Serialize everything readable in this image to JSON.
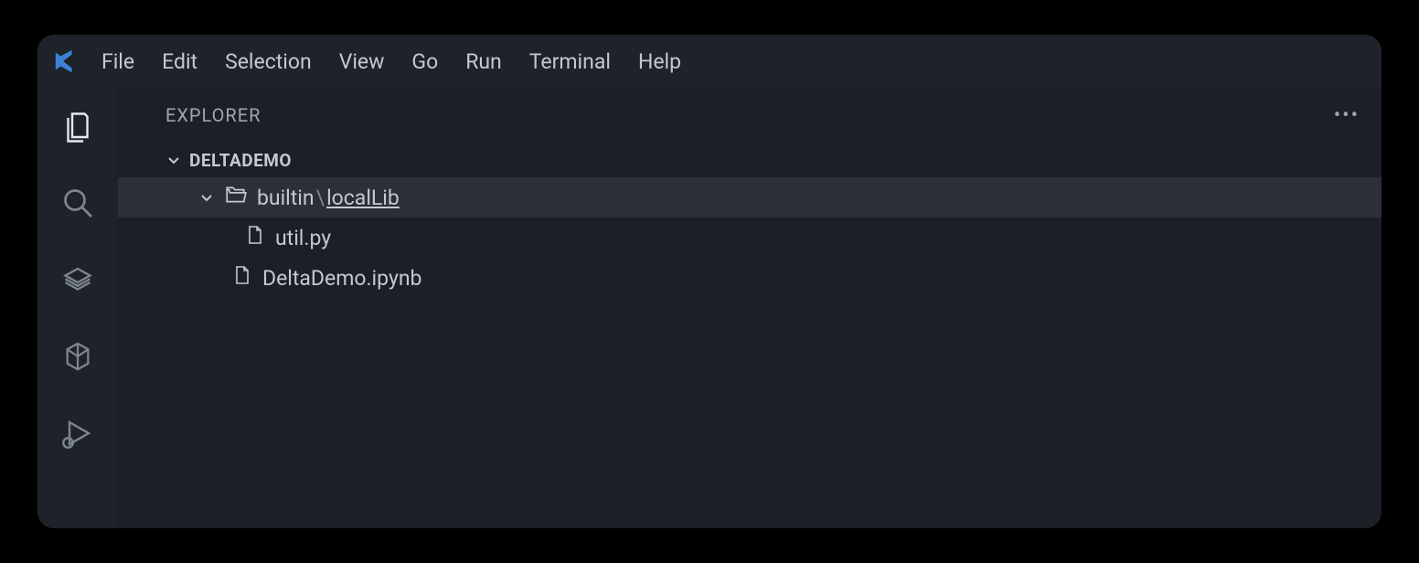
{
  "menu": {
    "file": "File",
    "edit": "Edit",
    "selection": "Selection",
    "view": "View",
    "go": "Go",
    "run": "Run",
    "terminal": "Terminal",
    "help": "Help"
  },
  "sidebar": {
    "title": "EXPLORER",
    "project": "DELTADEMO"
  },
  "tree": {
    "folder": {
      "prefix": "builtin",
      "separator": "\\",
      "name": "localLib"
    },
    "file1": "util.py",
    "file2": "DeltaDemo.ipynb"
  }
}
